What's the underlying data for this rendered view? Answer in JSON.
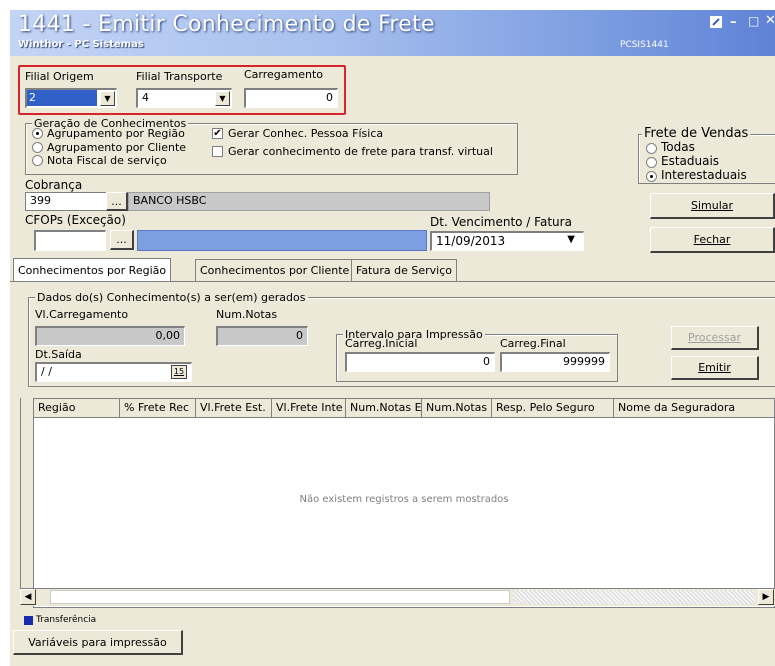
{
  "window": {
    "title": "1441 - Emitir Conhecimento de Frete",
    "subtitle": "Winthor - PC Sistemas",
    "code": "PCSIS1441"
  },
  "filial_origem": {
    "label": "Filial Origem",
    "value": "2"
  },
  "filial_transporte": {
    "label": "Filial Transporte",
    "value": "4"
  },
  "carregamento": {
    "label": "Carregamento",
    "value": "0"
  },
  "geracao": {
    "title": "Geração de Conhecimentos",
    "options": [
      "Agrupamento por Região",
      "Agrupamento por Cliente",
      "Nota Fiscal de serviço"
    ],
    "checks": [
      "Gerar Conhec. Pessoa Física",
      "Gerar conhecimento de frete para transf. virtual"
    ]
  },
  "frete_vendas": {
    "title": "Frete de Vendas",
    "options": [
      "Todas",
      "Estaduais",
      "Interestaduais"
    ]
  },
  "cobranca": {
    "label": "Cobrança",
    "code": "399",
    "name": "BANCO HSBC",
    "browse": "..."
  },
  "cfops": {
    "label": "CFOPs  (Exceção)",
    "browse": "..."
  },
  "vencimento": {
    "label": "Dt. Vencimento / Fatura",
    "value": "11/09/2013"
  },
  "buttons": {
    "simular": "Simular",
    "fechar": "Fechar",
    "processar": "Processar",
    "emitir": "Emitir",
    "variaveis": "Variáveis para impressão"
  },
  "tabs": [
    "Conhecimentos por Região",
    "Conhecimentos por Cliente",
    "Fatura de Serviço"
  ],
  "dados": {
    "title": "Dados do(s) Conhecimento(s) a ser(em) gerados",
    "vl_label": "Vl.Carregamento",
    "vl_value": "0,00",
    "num_label": "Num.Notas",
    "num_value": "0",
    "dt_label": "Dt.Saída",
    "dt_value": " / /",
    "dt_icon": "15"
  },
  "intervalo": {
    "title": "Intervalo para Impressão",
    "ini_label": "Carreg.Inicial",
    "ini_value": "0",
    "fin_label": "Carreg.Final",
    "fin_value": "999999"
  },
  "grid": {
    "columns": [
      "Região",
      "% Frete Rec",
      "Vl.Frete Est.",
      "Vl.Frete Inte",
      "Num.Notas E",
      "Num.Notas I",
      "Resp. Pelo Seguro",
      "Nome da Seguradora"
    ],
    "empty_message": "Não existem registros a serem mostrados"
  },
  "legend": {
    "label": "Transferência",
    "color": "#1a2aa8"
  },
  "colors": {
    "highlight": "#d9232d",
    "selected_field": "#7d9ee0"
  }
}
